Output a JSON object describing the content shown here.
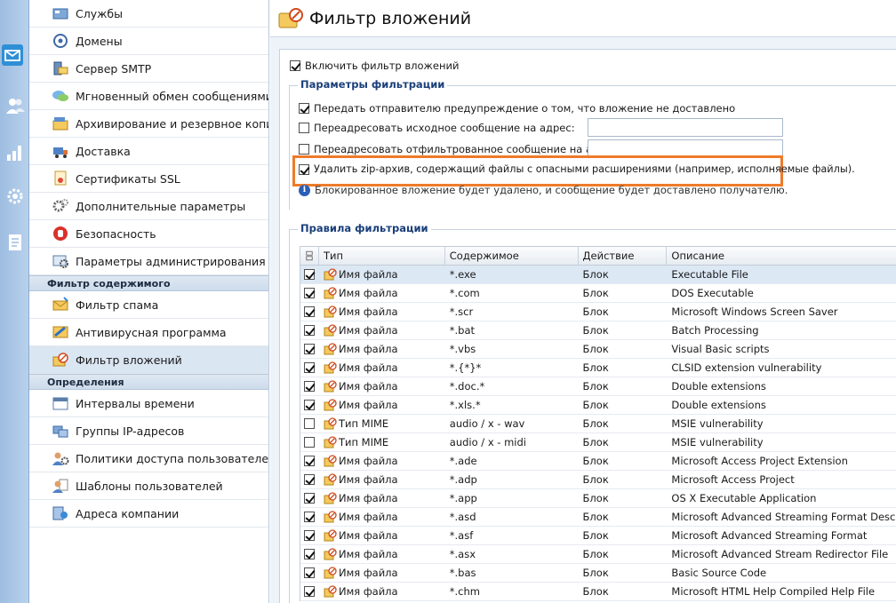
{
  "rail": {
    "icons": [
      "mail-icon",
      "users-icon",
      "chart-icon",
      "gear-icon",
      "document-icon"
    ]
  },
  "sidebar": {
    "items_top": [
      {
        "label": "Службы",
        "icon": "services-icon"
      },
      {
        "label": "Домены",
        "icon": "at-sign-icon"
      },
      {
        "label": "Сервер SMTP",
        "icon": "smtp-server-icon"
      },
      {
        "label": "Мгновенный обмен сообщениями",
        "icon": "chat-bubbles-icon"
      },
      {
        "label": "Архивирование и резервное копирование",
        "icon": "archive-icon"
      },
      {
        "label": "Доставка",
        "icon": "delivery-icon"
      },
      {
        "label": "Сертификаты SSL",
        "icon": "certificate-icon"
      },
      {
        "label": "Дополнительные параметры",
        "icon": "gears-icon"
      },
      {
        "label": "Безопасность",
        "icon": "stop-hand-icon"
      },
      {
        "label": "Параметры администрирования",
        "icon": "admin-settings-icon"
      }
    ],
    "section_content_filter": "Фильтр содержимого",
    "items_content": [
      {
        "label": "Фильтр спама",
        "icon": "spam-filter-icon"
      },
      {
        "label": "Антивирусная программа",
        "icon": "antivirus-icon"
      },
      {
        "label": "Фильтр вложений",
        "icon": "attachment-filter-icon"
      }
    ],
    "section_definitions": "Определения",
    "items_definitions": [
      {
        "label": "Интервалы времени",
        "icon": "calendar-book-icon"
      },
      {
        "label": "Группы IP-адресов",
        "icon": "ip-groups-icon"
      },
      {
        "label": "Политики доступа пользователей",
        "icon": "user-policies-icon"
      },
      {
        "label": "Шаблоны пользователей",
        "icon": "user-templates-icon"
      },
      {
        "label": "Адреса компании",
        "icon": "company-addresses-icon"
      }
    ]
  },
  "main": {
    "title": "Фильтр вложений",
    "enable_label": "Включить фильтр вложений",
    "params_legend": "Параметры фильтрации",
    "opt_notify": "Передать отправителю предупреждение о том, что вложение не доставлено",
    "opt_redirect_original": "Переадресовать исходное сообщение на адрес:",
    "opt_redirect_filtered": "Переадресовать отфильтрованное сообщение на адрес:",
    "opt_delete_zip": "Удалить zip-архив, содержащий файлы с опасными расширениями (например, исполняемые файлы).",
    "info_text": "Блокированное вложение будет удалено, и сообщение будет доставлено получателю.",
    "info_glyph": "i",
    "rules_legend": "Правила фильтрации",
    "columns": [
      "Тип",
      "Содержимое",
      "Действие",
      "Описание"
    ],
    "rules": [
      {
        "checked": true,
        "type": "Имя файла",
        "content": "*.exe",
        "action": "Блок",
        "desc": "Executable File"
      },
      {
        "checked": true,
        "type": "Имя файла",
        "content": "*.com",
        "action": "Блок",
        "desc": "DOS Executable"
      },
      {
        "checked": true,
        "type": "Имя файла",
        "content": "*.scr",
        "action": "Блок",
        "desc": "Microsoft Windows Screen Saver"
      },
      {
        "checked": true,
        "type": "Имя файла",
        "content": "*.bat",
        "action": "Блок",
        "desc": "Batch Processing"
      },
      {
        "checked": true,
        "type": "Имя файла",
        "content": "*.vbs",
        "action": "Блок",
        "desc": "Visual Basic scripts"
      },
      {
        "checked": true,
        "type": "Имя файла",
        "content": "*.{*}*",
        "action": "Блок",
        "desc": "CLSID extension vulnerability"
      },
      {
        "checked": true,
        "type": "Имя файла",
        "content": "*.doc.*",
        "action": "Блок",
        "desc": "Double extensions"
      },
      {
        "checked": true,
        "type": "Имя файла",
        "content": "*.xls.*",
        "action": "Блок",
        "desc": "Double extensions"
      },
      {
        "checked": false,
        "type": "Тип MIME",
        "content": "audio / x - wav",
        "action": "Блок",
        "desc": "MSIE vulnerability"
      },
      {
        "checked": false,
        "type": "Тип MIME",
        "content": "audio / x - midi",
        "action": "Блок",
        "desc": "MSIE vulnerability"
      },
      {
        "checked": true,
        "type": "Имя файла",
        "content": "*.ade",
        "action": "Блок",
        "desc": "Microsoft Access Project Extension"
      },
      {
        "checked": true,
        "type": "Имя файла",
        "content": "*.adp",
        "action": "Блок",
        "desc": "Microsoft Access Project"
      },
      {
        "checked": true,
        "type": "Имя файла",
        "content": "*.app",
        "action": "Блок",
        "desc": "OS X Executable Application"
      },
      {
        "checked": true,
        "type": "Имя файла",
        "content": "*.asd",
        "action": "Блок",
        "desc": "Microsoft Advanced Streaming Format Description"
      },
      {
        "checked": true,
        "type": "Имя файла",
        "content": "*.asf",
        "action": "Блок",
        "desc": "Microsoft Advanced Streaming Format"
      },
      {
        "checked": true,
        "type": "Имя файла",
        "content": "*.asx",
        "action": "Блок",
        "desc": "Microsoft Advanced Stream Redirector File"
      },
      {
        "checked": true,
        "type": "Имя файла",
        "content": "*.bas",
        "action": "Блок",
        "desc": "Basic Source Code"
      },
      {
        "checked": true,
        "type": "Имя файла",
        "content": "*.chm",
        "action": "Блок",
        "desc": "Microsoft HTML Help Compiled Help File"
      }
    ]
  },
  "colors": {
    "highlight": "#ee7b2a",
    "rail_active": "#2f8fd6",
    "selected_item": "#dbe6f3",
    "legend_text": "#1a3f7a"
  }
}
